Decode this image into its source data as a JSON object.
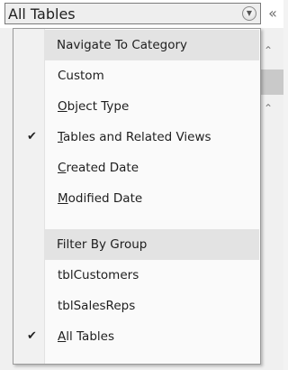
{
  "header": {
    "title": "All Tables",
    "dropdown_icon": "chevron-down-circle-icon",
    "shutter_icon": "double-chevron-left-icon",
    "shutter_glyph": "«"
  },
  "menu": {
    "sections": [
      {
        "label": "Navigate To Category"
      },
      {
        "label": "Filter By Group"
      }
    ],
    "items": [
      {
        "label": "Custom",
        "accel": "",
        "checked": false
      },
      {
        "label": "Object Type",
        "accel": "O",
        "checked": false
      },
      {
        "label": "Tables and Related Views",
        "accel": "T",
        "checked": true
      },
      {
        "label": "Created Date",
        "accel": "C",
        "checked": false
      },
      {
        "label": "Modified Date",
        "accel": "M",
        "checked": false
      },
      {
        "label": "tblCustomers",
        "accel": "",
        "checked": false
      },
      {
        "label": "tblSalesReps",
        "accel": "",
        "checked": false
      },
      {
        "label": "All Tables",
        "accel": "A",
        "checked": true
      }
    ],
    "check_glyph": "✔"
  },
  "pane": {
    "collapse_glyph": "⌃"
  }
}
